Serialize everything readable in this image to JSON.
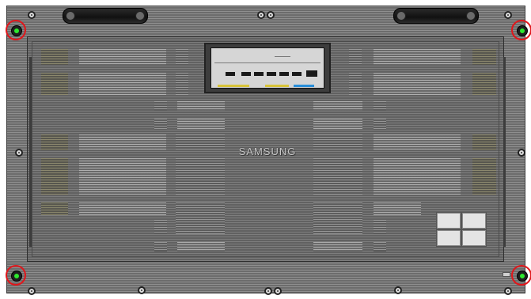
{
  "logo": {
    "text": "SAMSUNG"
  },
  "colors": {
    "mount_highlight": "#e0161b",
    "mount_core": "#2ee82e",
    "io_port_accent": "#2a8fd9",
    "io_port_accent2": "#d8c43a"
  },
  "icons": [
    "handle-icon",
    "screw-icon",
    "mount-hole-icon"
  ]
}
